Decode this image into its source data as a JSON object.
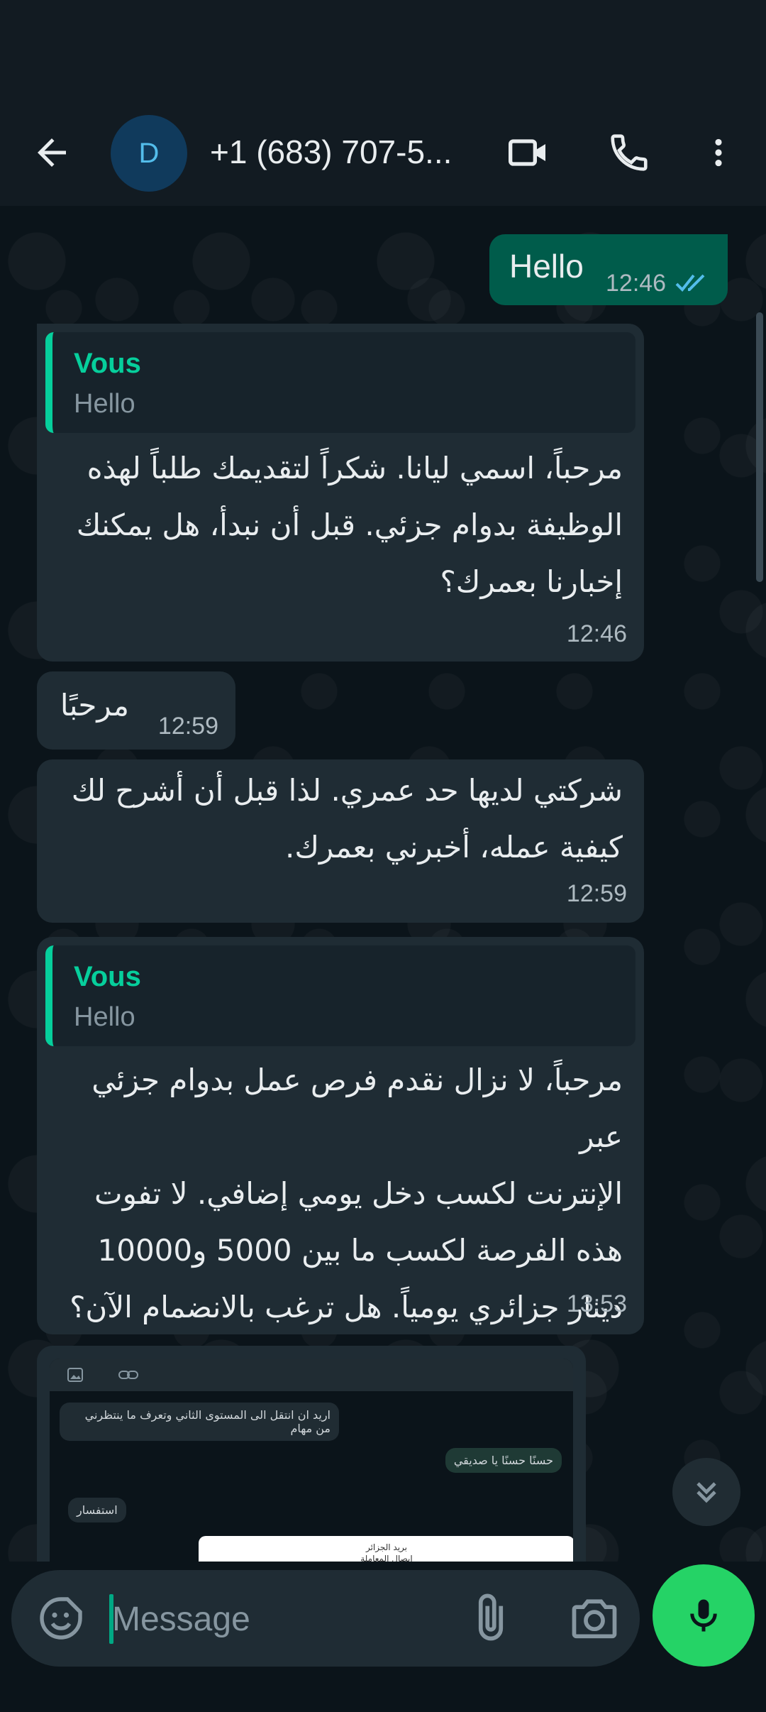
{
  "header": {
    "avatar_letter": "D",
    "contact_name": "+1 (683) 707-5...",
    "icons": [
      "back-arrow-icon",
      "video-call-icon",
      "phone-icon",
      "more-vertical-icon"
    ]
  },
  "messages": [
    {
      "direction": "out",
      "text": "Hello",
      "time": "12:46",
      "status": "read"
    },
    {
      "direction": "in",
      "quote": {
        "name": "Vous",
        "text": "Hello"
      },
      "lines": [
        "مرحباً، اسمي ليانا. شكراً لتقديمك طلباً لهذه",
        "الوظيفة بدوام جزئي. قبل أن نبدأ، هل يمكنك",
        "إخبارنا بعمرك؟"
      ],
      "time": "12:46"
    },
    {
      "direction": "in",
      "text": "مرحبًا",
      "time": "12:59"
    },
    {
      "direction": "in",
      "lines": [
        "شركتي لديها حد عمري. لذا قبل أن أشرح لك",
        "كيفية عمله، أخبرني بعمرك."
      ],
      "time": "12:59"
    },
    {
      "direction": "in",
      "quote": {
        "name": "Vous",
        "text": "Hello"
      },
      "lines": [
        "مرحباً، لا نزال نقدم فرص عمل بدوام جزئي عبر",
        "الإنترنت لكسب دخل يومي إضافي. لا تفوت",
        "هذه الفرصة لكسب ما بين 5000 و10000",
        "دينار جزائري يومياً. هل ترغب بالانضمام الآن؟"
      ],
      "time": "13:53"
    },
    {
      "direction": "in",
      "type": "image",
      "image_texts": [
        "اريد ان انتقل الى المستوى الثاني وتعرف ما ينتظرني من مهام",
        "حسنًا حسنًا يا صديقي",
        "استفسار",
        "بريد الجزائر",
        "إيصال المعاملة"
      ]
    }
  ],
  "composer": {
    "placeholder": "Message",
    "icons": [
      "sticker-icon",
      "attach-icon",
      "camera-icon",
      "mic-icon"
    ]
  },
  "colors": {
    "outgoing_bubble": "#005c4b",
    "incoming_bubble": "#1f2c34",
    "accent": "#25d366",
    "quote_name": "#06cf9c",
    "read_ticks": "#53bdeb"
  }
}
